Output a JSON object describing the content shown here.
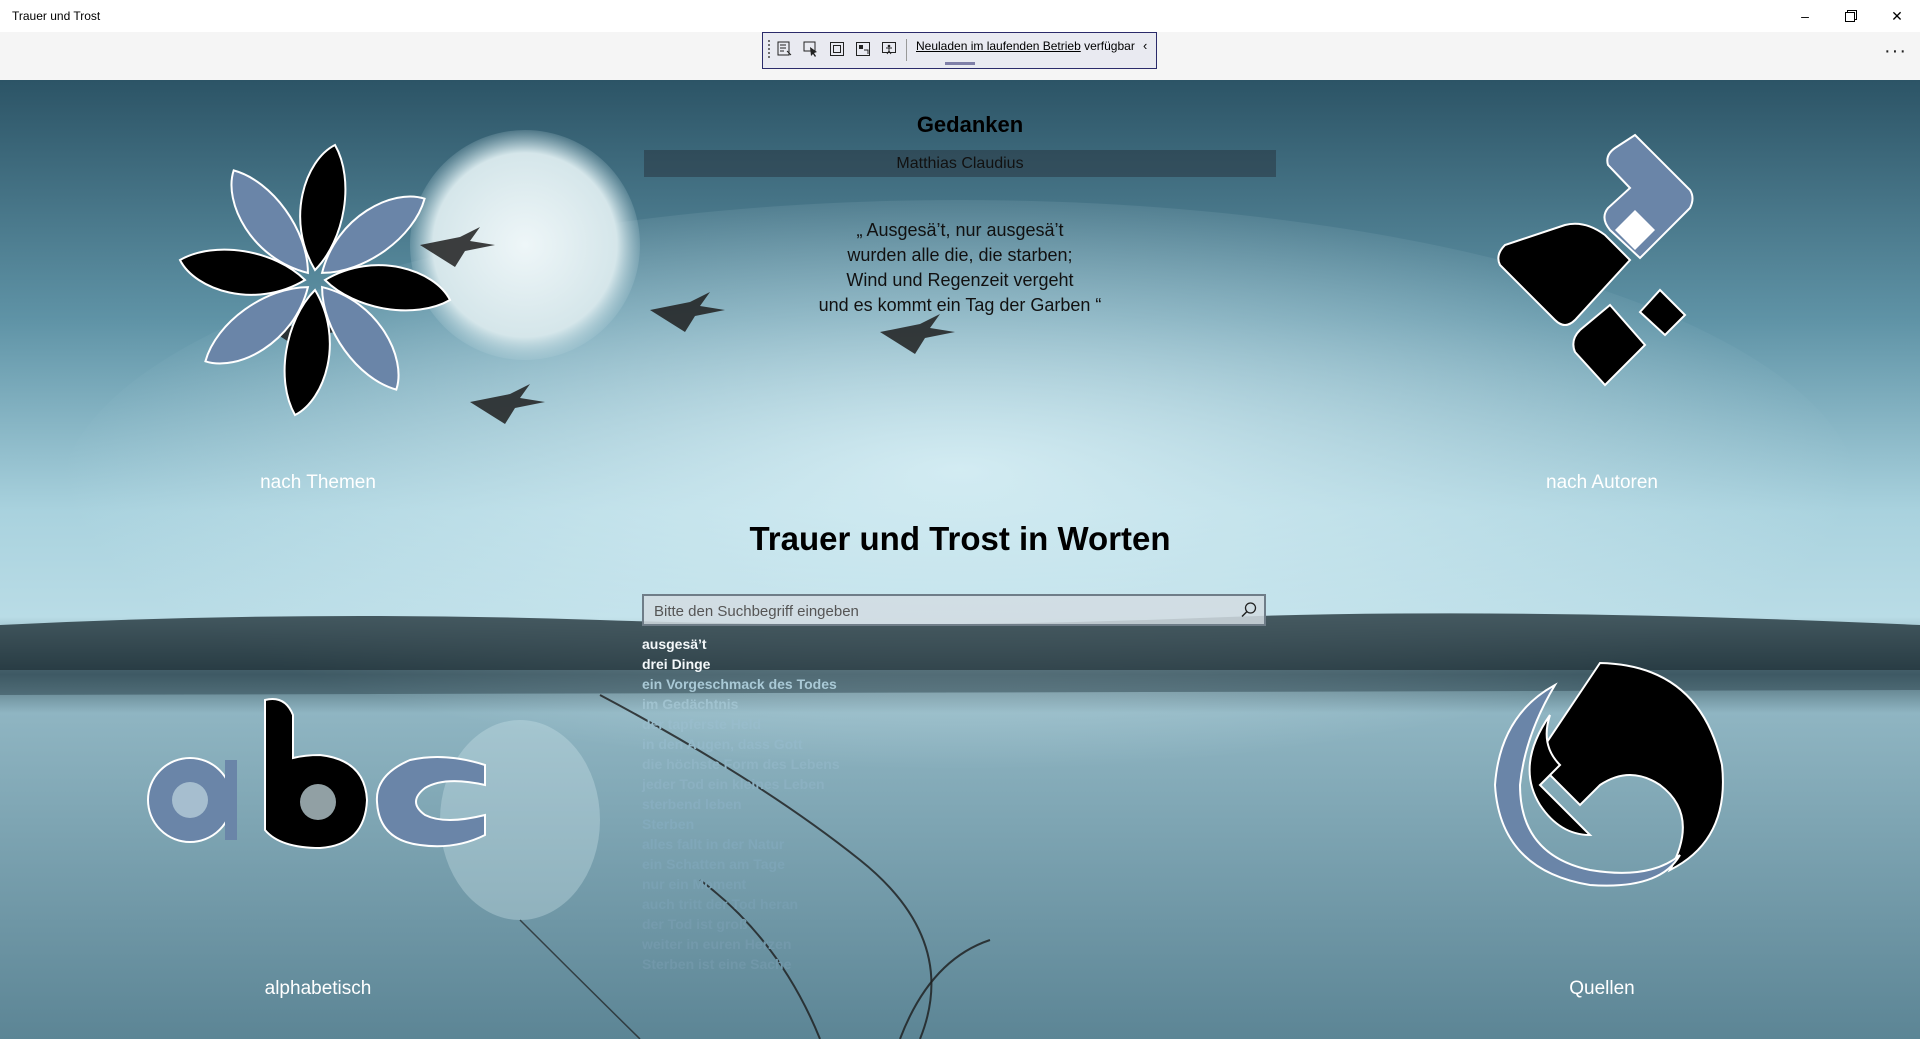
{
  "window": {
    "title": "Trauer und Trost",
    "minimize": "–",
    "maximize": "❐",
    "close": "✕"
  },
  "debug_toolbar": {
    "hot_reload_link": "Neuladen im laufenden Betrieb",
    "hot_reload_suffix": " verfügbar",
    "collapse_glyph": "‹"
  },
  "command_bar": {
    "more": "···"
  },
  "poem": {
    "title": "Gedanken",
    "author": "Matthias  Claudius",
    "lines": [
      "„ Ausgesä’t, nur ausgesä’t",
      "wurden alle die, die starben;",
      "Wind und Regenzeit vergeht",
      "und es kommt ein Tag der Garben “"
    ]
  },
  "tiles": {
    "themes": "nach Themen",
    "authors": "nach Autoren",
    "alphabetical": "alphabetisch",
    "sources": "Quellen"
  },
  "heading": "Trauer und Trost in Worten",
  "search": {
    "placeholder": "Bitte den Suchbegriff eingeben"
  },
  "suggestions": [
    "ausgesä’t",
    "drei Dinge",
    "ein Vorgeschmack des Todes",
    "im Gedächtnis",
    "der tapferste Held",
    "in den Augen, dass Gott",
    "die höchste Form des Lebens",
    "jeder Tod ein kleines Leben",
    "sterbend leben",
    "Sterben",
    "alles fallt in der Natur",
    "ein Schatten am Tage",
    "nur ein Moment",
    "auch tritt der Tod heran",
    "der Tod ist groß",
    "weiter in euren Herzen",
    "Sterben ist eine Sache"
  ],
  "colors": {
    "tile_blue": "#6a85a8",
    "tile_black": "#000000",
    "suggestion_active": "#f4f8fa",
    "suggestion_dim": "#8fb0c2"
  }
}
